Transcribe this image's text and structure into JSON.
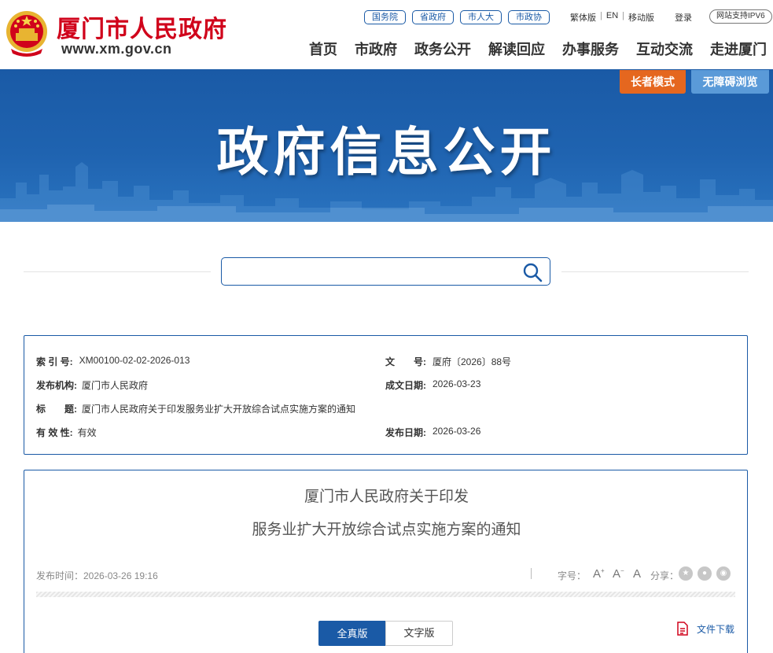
{
  "header": {
    "site_name": "厦门市人民政府",
    "site_url": "www.xm.gov.cn",
    "quick_links": [
      "国务院",
      "省政府",
      "市人大",
      "市政协"
    ],
    "util_links": [
      "繁体版",
      "EN",
      "移动版"
    ],
    "login": "登录",
    "ipv6": "网站支持IPV6",
    "nav": [
      "首页",
      "市政府",
      "政务公开",
      "解读回应",
      "办事服务",
      "互动交流",
      "走进厦门"
    ]
  },
  "banner": {
    "title": "政府信息公开",
    "elder_mode": "长者模式",
    "accessible": "无障碍浏览"
  },
  "search": {
    "placeholder": ""
  },
  "meta": {
    "index_label": "索 引 号:",
    "index_value": "XM00100-02-02-2026-013",
    "doc_no_label": "文　　号:",
    "doc_no_value": "厦府〔2026〕88号",
    "publisher_label": "发布机构:",
    "publisher_value": "厦门市人民政府",
    "written_date_label": "成文日期:",
    "written_date_value": "2026-03-23",
    "title_label": "标　　题:",
    "title_value": "厦门市人民政府关于印发服务业扩大开放综合试点实施方案的通知",
    "validity_label": "有 效 性:",
    "validity_value": "有效",
    "pub_date_label": "发布日期:",
    "pub_date_value": "2026-03-26"
  },
  "doc": {
    "title_line1": "厦门市人民政府关于印发",
    "title_line2": "服务业扩大开放综合试点实施方案的通知",
    "pub_time": "发布时间：2026-03-26 19:16",
    "font_size_label": "字号：",
    "font_large": "A",
    "font_small": "A",
    "font_normal": "A",
    "share_label": "分享：",
    "tab_full": "全真版",
    "tab_text": "文字版",
    "download": "文件下载"
  },
  "colors": {
    "brand_red": "#d0021b",
    "brand_blue": "#1a5aa6",
    "elder_orange": "#e5671f",
    "access_blue": "#5a9ad8"
  }
}
